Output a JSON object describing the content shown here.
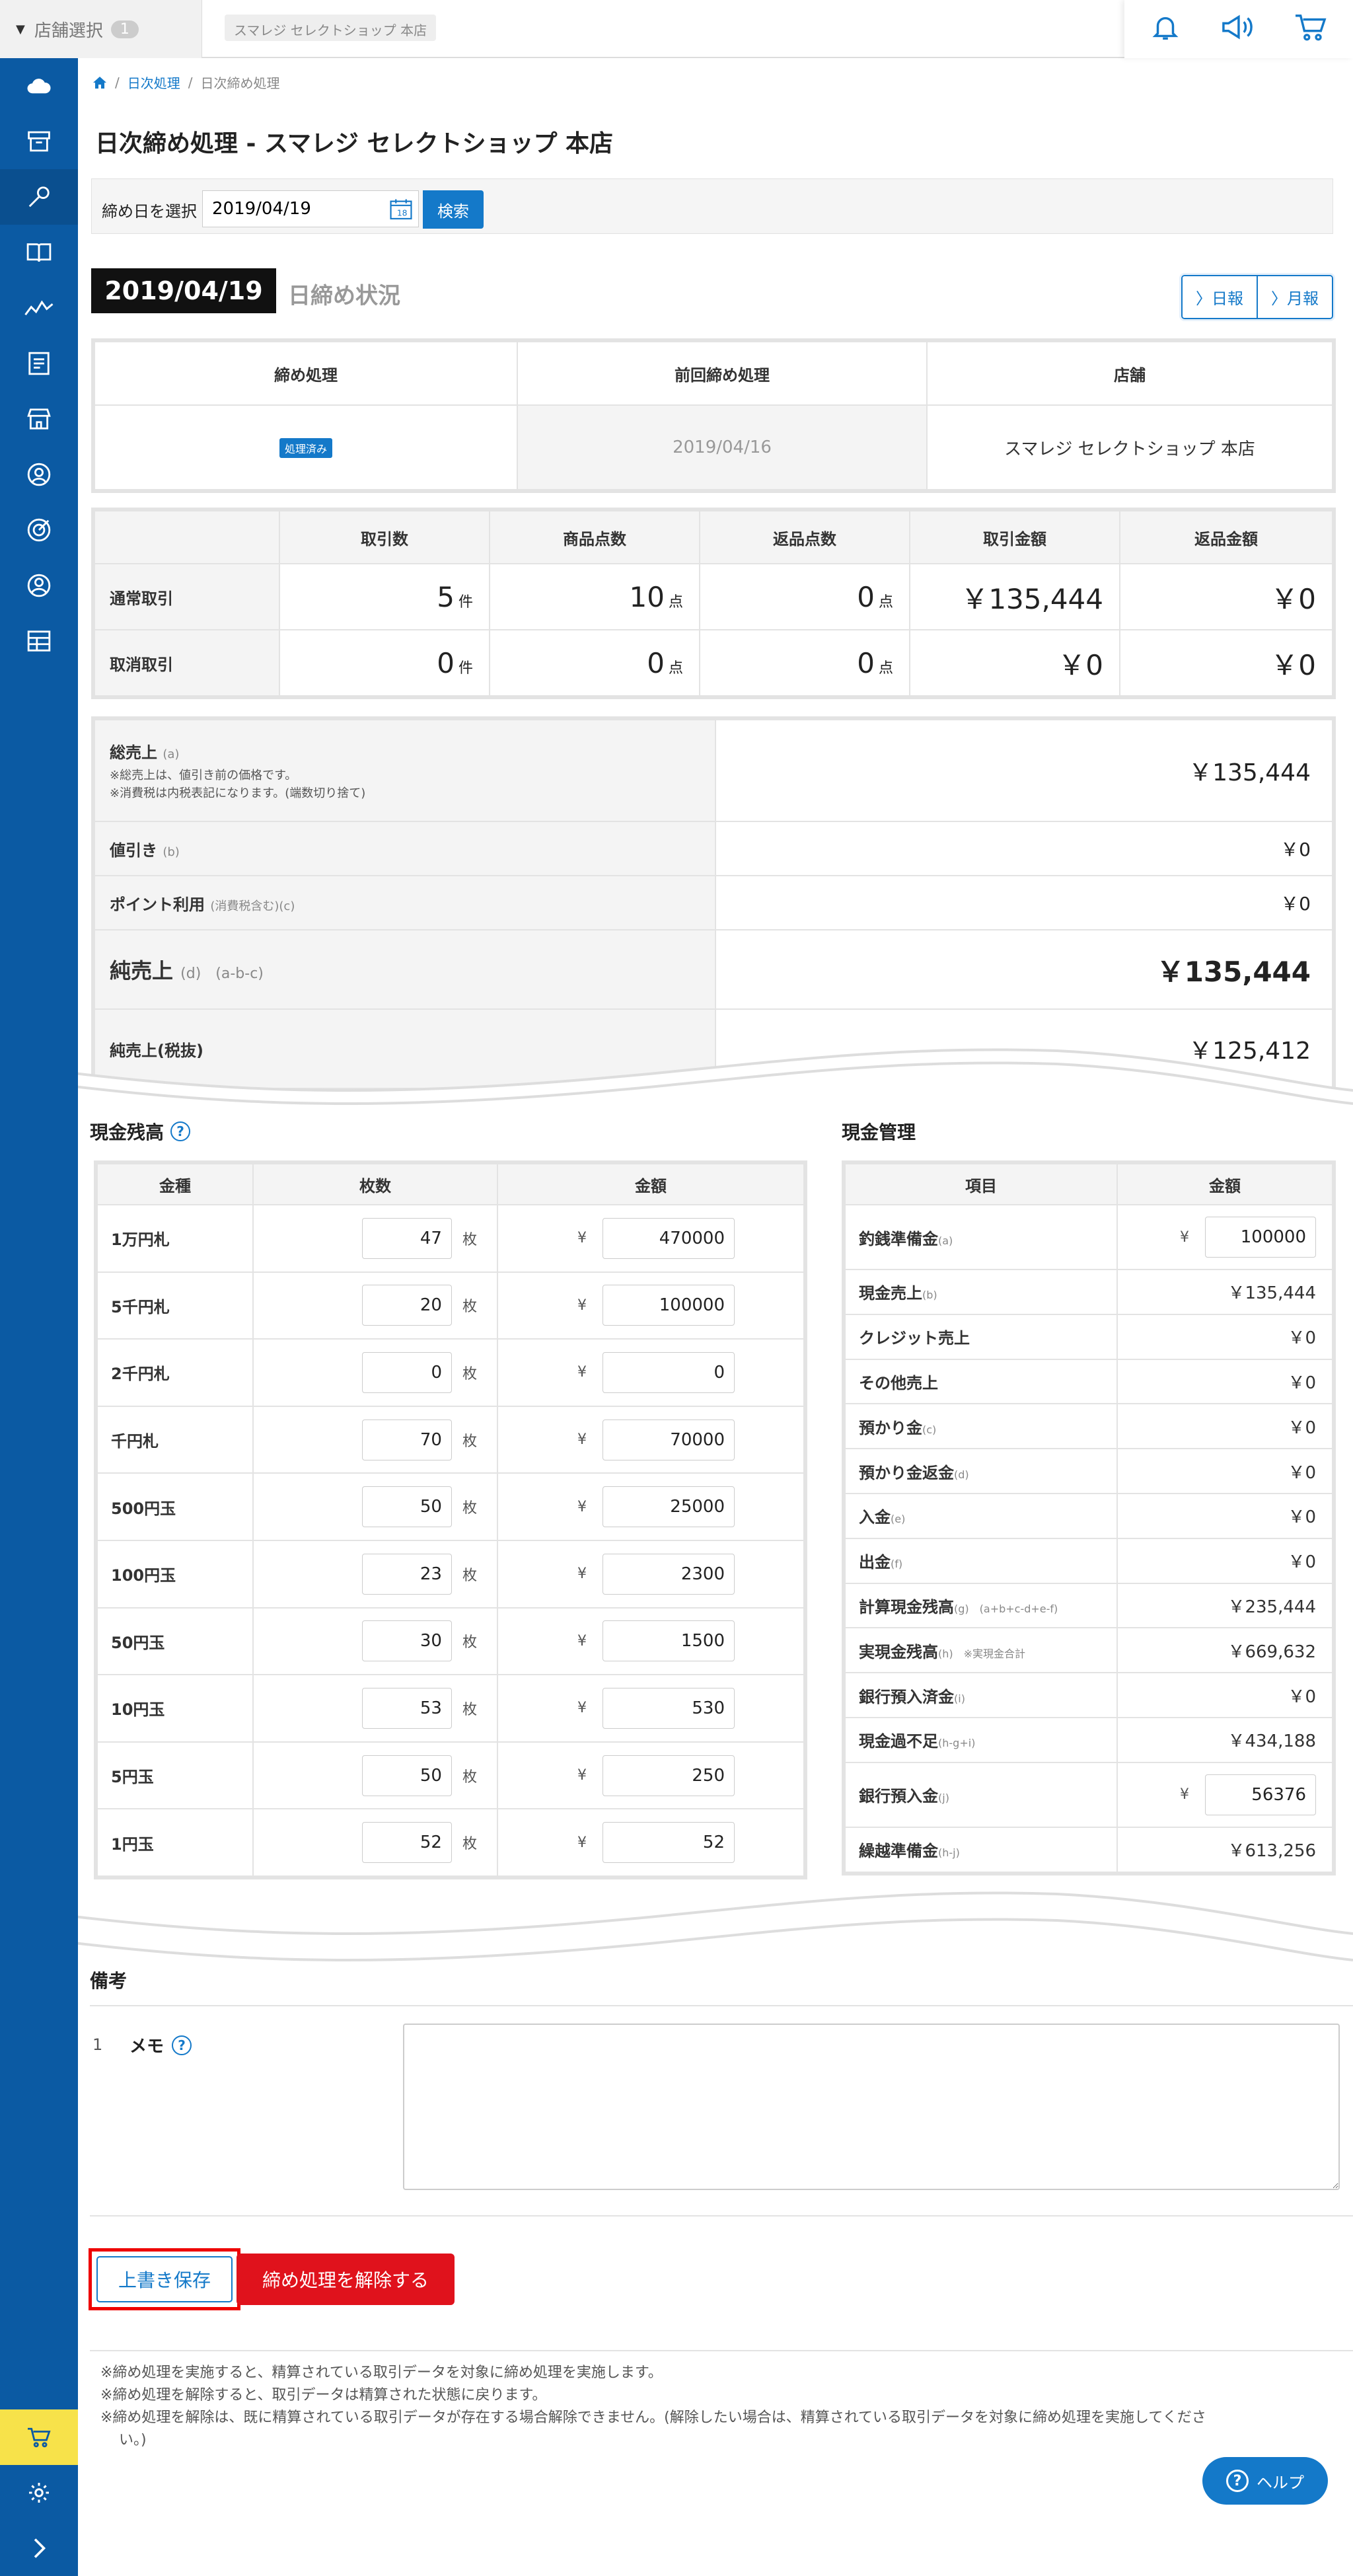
{
  "topbar": {
    "store_select_label": "店舗選択",
    "store_count": "1",
    "store_name": "スマレジ セレクトショップ 本店",
    "icons": [
      "bell-icon",
      "megaphone-icon",
      "cart-icon"
    ]
  },
  "sidebar": {
    "items": [
      "cloud-icon",
      "archive-box-icon",
      "wrench-icon",
      "book-icon",
      "chart-line-icon",
      "report-icon",
      "store-icon",
      "customer-icon",
      "target-icon",
      "staff-icon",
      "grid-icon"
    ],
    "bottom": [
      "cart-icon",
      "gear-icon",
      "chevron-right-icon"
    ]
  },
  "breadcrumb": {
    "home_icon": "home-icon",
    "items": [
      "日次処理",
      "日次締め処理"
    ]
  },
  "page": {
    "title": "日次締め処理 - スマレジ セレクトショップ 本店"
  },
  "date_filter": {
    "label": "締め日を選択",
    "value": "2019/04/19",
    "search_label": "検索"
  },
  "status": {
    "date": "2019/04/19",
    "label": "日締め状況",
    "daily_btn": "日報",
    "monthly_btn": "月報"
  },
  "close_table": {
    "headers": [
      "締め処理",
      "前回締め処理",
      "店舗"
    ],
    "badge": "処理済み",
    "previous": "2019/04/16",
    "store": "スマレジ セレクトショップ 本店"
  },
  "trans_table": {
    "headers": [
      "",
      "取引数",
      "商品点数",
      "返品点数",
      "取引金額",
      "返品金額"
    ],
    "rows": [
      {
        "label": "通常取引",
        "count": "5",
        "count_unit": "件",
        "items": "10",
        "items_unit": "点",
        "returns": "0",
        "returns_unit": "点",
        "amount": "￥135,444",
        "return_amount": "￥0"
      },
      {
        "label": "取消取引",
        "count": "0",
        "count_unit": "件",
        "items": "0",
        "items_unit": "点",
        "returns": "0",
        "returns_unit": "点",
        "amount": "￥0",
        "return_amount": "￥0"
      }
    ]
  },
  "sales": {
    "gross_label": "総売上",
    "gross_sub": "(a)",
    "gross_note1": "※総売上は、値引き前の価格です。",
    "gross_note2": "※消費税は内税表記になります。(端数切り捨て)",
    "gross_value": "￥135,444",
    "discount_label": "値引き",
    "discount_sub": "(b)",
    "discount_value": "￥0",
    "point_label": "ポイント利用",
    "point_sub": "(消費税含む)(c)",
    "point_value": "￥0",
    "net_label": "純売上",
    "net_sub": "(d)　(a-b-c)",
    "net_value": "￥135,444",
    "net_ex_label": "純売上(税抜)",
    "net_ex_value": "￥125,412"
  },
  "cash": {
    "title": "現金残高",
    "headers": [
      "金種",
      "枚数",
      "金額"
    ],
    "count_unit": "枚",
    "yen": "¥",
    "rows": [
      {
        "label": "1万円札",
        "count": "47",
        "amount": "470000"
      },
      {
        "label": "5千円札",
        "count": "20",
        "amount": "100000"
      },
      {
        "label": "2千円札",
        "count": "0",
        "amount": "0"
      },
      {
        "label": "千円札",
        "count": "70",
        "amount": "70000"
      },
      {
        "label": "500円玉",
        "count": "50",
        "amount": "25000"
      },
      {
        "label": "100円玉",
        "count": "23",
        "amount": "2300"
      },
      {
        "label": "50円玉",
        "count": "30",
        "amount": "1500"
      },
      {
        "label": "10円玉",
        "count": "53",
        "amount": "530"
      },
      {
        "label": "5円玉",
        "count": "50",
        "amount": "250"
      },
      {
        "label": "1円玉",
        "count": "52",
        "amount": "52"
      }
    ]
  },
  "mgmt": {
    "title": "現金管理",
    "headers": [
      "項目",
      "金額"
    ],
    "change_label": "釣銭準備金",
    "change_sub": "(a)",
    "change_yen": "¥",
    "change_value": "100000",
    "cash_sales_label": "現金売上",
    "cash_sales_sub": "(b)",
    "cash_sales_value": "￥135,444",
    "credit_label": "クレジット売上",
    "credit_value": "￥0",
    "other_label": "その他売上",
    "other_value": "￥0",
    "deposit_label": "預かり金",
    "deposit_sub": "(c)",
    "deposit_value": "￥0",
    "deposit_return_label": "預かり金返金",
    "deposit_return_sub": "(d)",
    "deposit_return_value": "￥0",
    "in_label": "入金",
    "in_sub": "(e)",
    "in_value": "￥0",
    "out_label": "出金",
    "out_sub": "(f)",
    "out_value": "￥0",
    "calc_label": "計算現金残高",
    "calc_sub": "(g)　(a+b+c-d+e-f)",
    "calc_value": "￥235,444",
    "actual_label": "実現金残高",
    "actual_sub": "(h)　※実現金合計",
    "actual_value": "￥669,632",
    "bank_done_label": "銀行預入済金",
    "bank_done_sub": "(i)",
    "bank_done_value": "￥0",
    "diff_label": "現金過不足",
    "diff_sub": "(h-g+i)",
    "diff_value": "￥434,188",
    "bank_label": "銀行預入金",
    "bank_sub": "(j)",
    "bank_yen": "¥",
    "bank_value": "56376",
    "carry_label": "繰越準備金",
    "carry_sub": "(h-j)",
    "carry_value": "￥613,256"
  },
  "remarks": {
    "title": "備考",
    "no": "1",
    "memo_label": "メモ"
  },
  "actions": {
    "save": "上書き保存",
    "unclose": "締め処理を解除する"
  },
  "notes": [
    "※締め処理を実施すると、精算されている取引データを対象に締め処理を実施します。",
    "※締め処理を解除すると、取引データは精算された状態に戻ります。",
    "※締め処理を解除は、既に精算されている取引データが存在する場合解除できません。(解除したい場合は、精算されている取引データを対象に締め処理を実施してくださ",
    "い。)"
  ],
  "help": {
    "label": "ヘルプ"
  }
}
